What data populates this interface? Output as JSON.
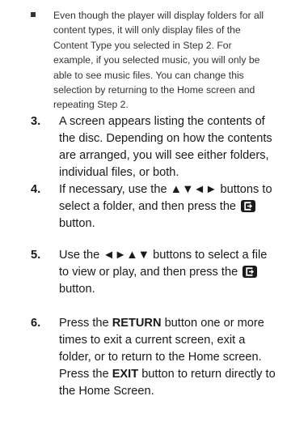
{
  "note": {
    "text": "Even though the player will display folders for all content types, it will only display files of the Content Type you selected in Step 2. For example, if you selected music, you will only be able to see music files. You can change this selection by returning to the Home screen and repeating Step 2."
  },
  "steps": [
    {
      "number": "3.",
      "text": "A screen appears listing the contents of the disc. Depending on how the contents are arranged, you will see either folders, individual files, or both."
    },
    {
      "number": "4.",
      "text_before": "If necessary, use the ▲▼◄► buttons to select a folder, and then press the",
      "icon": "enter-icon",
      "text_after": "button."
    },
    {
      "number": "5.",
      "text_before": "Use the ◄►▲▼ buttons to select a file to view or play, and then press the",
      "icon": "enter-icon",
      "text_after": "button."
    },
    {
      "number": "6.",
      "text_a": "Press the ",
      "bold_a": "RETURN",
      "text_b": " button one or more times to exit a current screen, exit a folder, or to return to the Home screen. Press the ",
      "bold_b": "EXIT",
      "text_c": " button to return directly to the Home Screen."
    }
  ],
  "colors": {
    "text": "#1a1a1a",
    "note_text": "#333333"
  }
}
